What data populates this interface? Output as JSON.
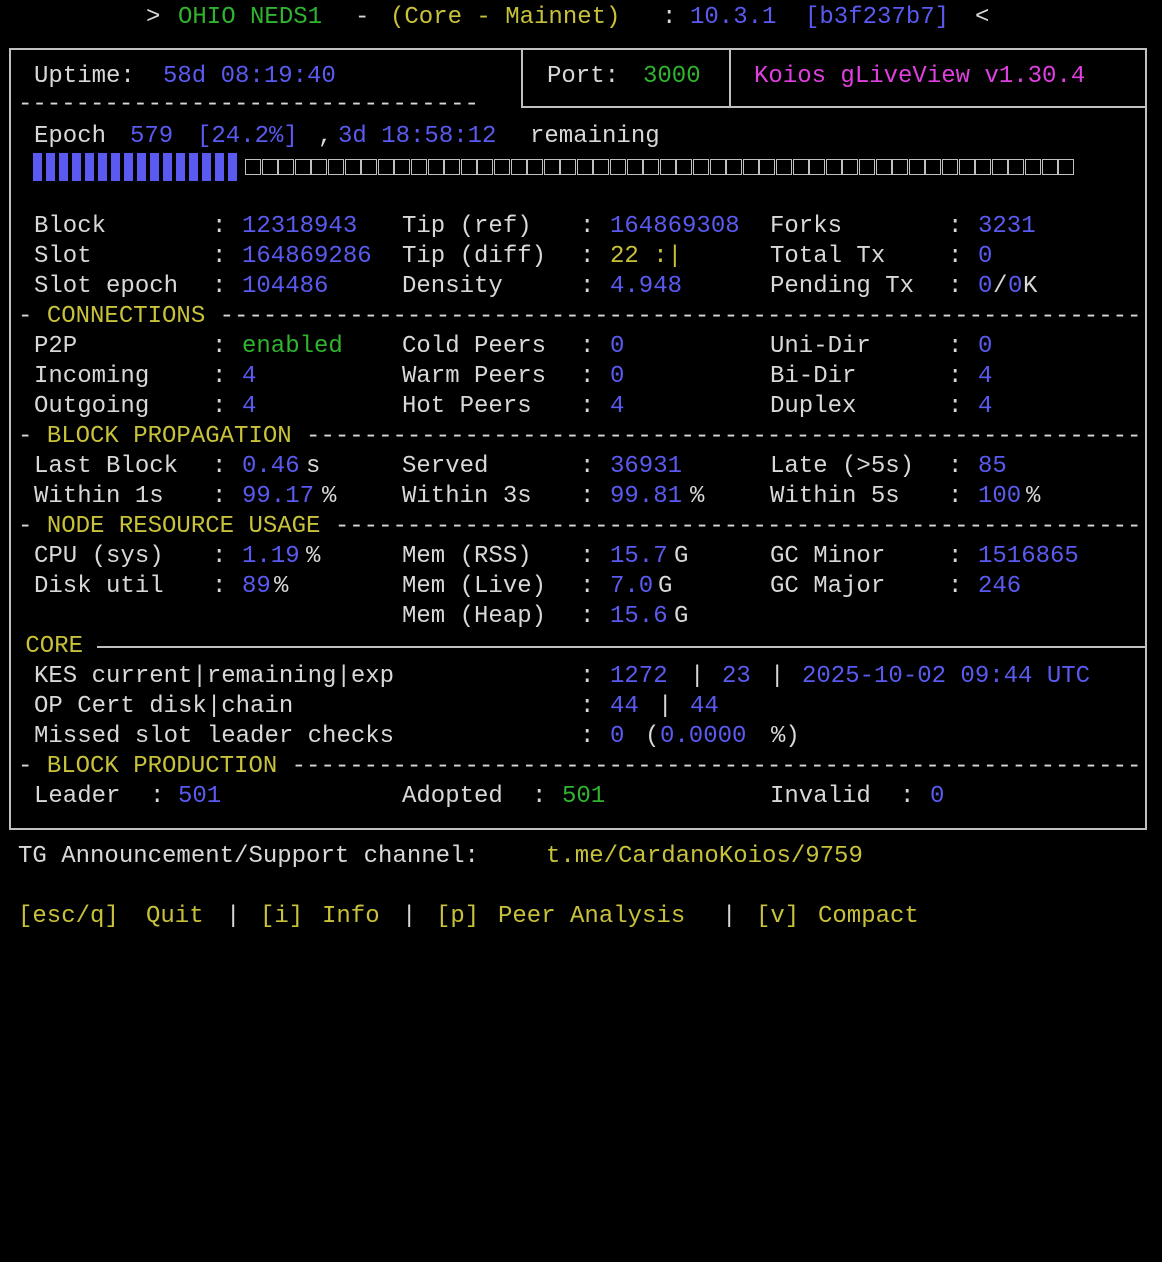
{
  "header": {
    "prefix": ">",
    "node_name": "OHIO NEDS1",
    "dash": "-",
    "mode": "(Core - Mainnet)",
    "colon": ":",
    "version": "10.3.1",
    "commit": "[b3f237b7]",
    "suffix": "<"
  },
  "top": {
    "uptime_label": "Uptime:",
    "uptime_value": "58d 08:19:40",
    "port_label": "Port:",
    "port_value": "3000",
    "app_title": "Koios gLiveView v1.30.4"
  },
  "epoch": {
    "label": "Epoch",
    "number": "579",
    "percent": "[24.2%]",
    "comma": ",",
    "time_left": "3d 18:58:12",
    "remaining": "remaining",
    "progress_fraction": 0.242
  },
  "chain": {
    "block_label": "Block",
    "block_value": "12318943",
    "slot_label": "Slot",
    "slot_value": "164869286",
    "slot_epoch_label": "Slot epoch",
    "slot_epoch_value": "104486",
    "tip_ref_label": "Tip (ref)",
    "tip_ref_value": "164869308",
    "tip_diff_label": "Tip (diff)",
    "tip_diff_value": "22 :|",
    "density_label": "Density",
    "density_value": "4.948",
    "forks_label": "Forks",
    "forks_value": "3231",
    "total_tx_label": "Total Tx",
    "total_tx_value": "0",
    "pending_tx_label": "Pending Tx",
    "pending_tx_a": "0",
    "pending_tx_sep": "/",
    "pending_tx_b": "0",
    "pending_tx_unit": "K"
  },
  "connections": {
    "title": "CONNECTIONS",
    "p2p_label": "P2P",
    "p2p_value": "enabled",
    "incoming_label": "Incoming",
    "incoming_value": "4",
    "outgoing_label": "Outgoing",
    "outgoing_value": "4",
    "cold_label": "Cold Peers",
    "cold_value": "0",
    "warm_label": "Warm Peers",
    "warm_value": "0",
    "hot_label": "Hot Peers",
    "hot_value": "4",
    "uni_label": "Uni-Dir",
    "uni_value": "0",
    "bi_label": "Bi-Dir",
    "bi_value": "4",
    "duplex_label": "Duplex",
    "duplex_value": "4"
  },
  "propagation": {
    "title": "BLOCK PROPAGATION",
    "last_label": "Last Block",
    "last_value": "0.46",
    "last_unit": "s",
    "within1_label": "Within 1s",
    "within1_value": "99.17",
    "within1_unit": "%",
    "served_label": "Served",
    "served_value": "36931",
    "within3_label": "Within 3s",
    "within3_value": "99.81",
    "within3_unit": "%",
    "late_label": "Late (>5s)",
    "late_value": "85",
    "within5_label": "Within 5s",
    "within5_value": "100",
    "within5_unit": "%"
  },
  "resources": {
    "title": "NODE RESOURCE USAGE",
    "cpu_label": "CPU (sys)",
    "cpu_value": "1.19",
    "cpu_unit": "%",
    "disk_label": "Disk util",
    "disk_value": "89",
    "disk_unit": "%",
    "rss_label": "Mem (RSS)",
    "rss_value": "15.7",
    "rss_unit": "G",
    "live_label": "Mem (Live)",
    "live_value": "7.0",
    "live_unit": "G",
    "heap_label": "Mem (Heap)",
    "heap_value": "15.6",
    "heap_unit": "G",
    "gcmin_label": "GC Minor",
    "gcmin_value": "1516865",
    "gcmaj_label": "GC Major",
    "gcmaj_value": "246"
  },
  "core": {
    "title": "CORE",
    "kes_label": "KES current|remaining|exp",
    "kes_current": "1272",
    "kes_remaining": "23",
    "kes_exp": "2025-10-02 09:44 UTC",
    "opcert_label": "OP Cert disk|chain",
    "opcert_disk": "44",
    "opcert_chain": "44",
    "missed_label": "Missed slot leader checks",
    "missed_value": "0",
    "missed_pct": "0.0000",
    "missed_pct_unit": "%)",
    "pipe": "|",
    "open_paren": "("
  },
  "production": {
    "title": "BLOCK PRODUCTION",
    "leader_label": "Leader",
    "leader_value": "501",
    "adopted_label": "Adopted",
    "adopted_value": "501",
    "invalid_label": "Invalid",
    "invalid_value": "0"
  },
  "footer": {
    "announce_label": "TG Announcement/Support channel:",
    "announce_link": "t.me/CardanoKoios/9759",
    "menu": [
      {
        "key": "[esc/q]",
        "label": "Quit"
      },
      {
        "key": "[i]",
        "label": "Info"
      },
      {
        "key": "[p]",
        "label": "Peer Analysis"
      },
      {
        "key": "[v]",
        "label": "Compact"
      }
    ],
    "sep": "|"
  },
  "colors": {
    "value": "#5a5af0",
    "good": "#2fb42f",
    "section": "#c8c23a",
    "title": "#e040e0",
    "text": "#d8d8d8"
  },
  "misc": {
    "colon": ":"
  }
}
